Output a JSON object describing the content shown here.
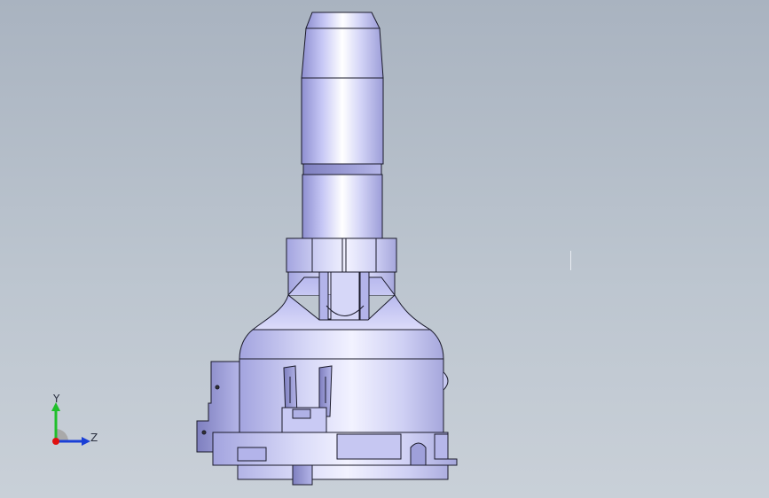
{
  "viewport": {
    "background_top": "#a9b3c0",
    "background_bottom": "#c9d0d8"
  },
  "part": {
    "name": "rotary-switch-model",
    "body_color": "#c8c9f2",
    "shade_color": "#8f90c8",
    "edge_color": "#1a1a2a"
  },
  "triad": {
    "y_label": "Y",
    "z_label": "Z",
    "y_color": "#1fbf2a",
    "z_color": "#1a3fd6",
    "x_color": "#e01010"
  }
}
